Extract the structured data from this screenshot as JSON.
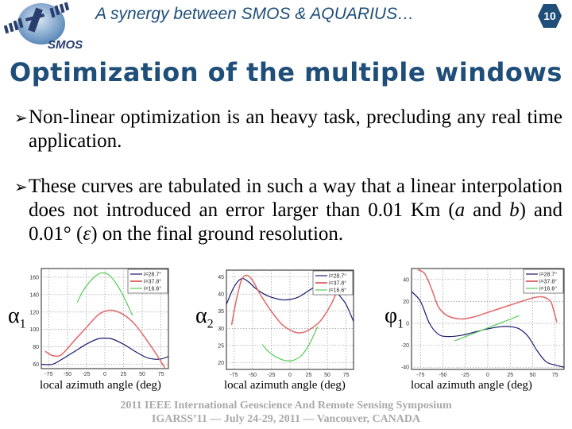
{
  "header": {
    "logo_text": "SMOS",
    "title": "A synergy between SMOS & AQUARIUS…",
    "slide_number": "10",
    "accent_color": "#1f4e79"
  },
  "slide": {
    "title": "Optimization of the multiple windows",
    "bullets": [
      {
        "icon": "arrow-bullet-icon",
        "text": "Non-linear optimization is an heavy task, precluding any real time application."
      },
      {
        "icon": "arrow-bullet-icon",
        "text_parts": [
          "These curves are tabulated in such a way that a linear interpolation does not introduced an error larger than 0.01 Km (",
          "a",
          " and ",
          "b",
          ") and 0.01° (",
          "ε",
          ") on the final ground resolution."
        ]
      }
    ]
  },
  "footer": {
    "line1": "2011 IEEE International Geoscience And Remote Sensing Symposium",
    "line2": "IGARSS’11 —  July 24-29, 2011 —  Vancouver, CANADA"
  },
  "chart_data": [
    {
      "type": "line",
      "ylabel": "α",
      "ylabel_sub": "1",
      "xlabel": "local azimuth angle (deg)",
      "xlim": [
        -85,
        85
      ],
      "ylim": [
        55,
        170
      ],
      "xticks": [
        -75,
        -50,
        -25,
        0,
        25,
        50,
        75
      ],
      "yticks": [
        60,
        80,
        100,
        120,
        140,
        160
      ],
      "grid": true,
      "legend": "top-right",
      "series": [
        {
          "name": "i=28.7°",
          "color": "#1a1a6e",
          "x": [
            -85,
            -70,
            -55,
            -40,
            -25,
            -10,
            0,
            10,
            25,
            40,
            55,
            65,
            75,
            85
          ],
          "y": [
            60,
            60,
            67,
            75,
            83,
            89,
            90,
            89,
            83,
            75,
            68,
            66,
            66,
            69
          ]
        },
        {
          "name": "i=37.8°",
          "color": "#e07070",
          "x": [
            -80,
            -70,
            -60,
            -50,
            -40,
            -25,
            -10,
            0,
            10,
            25,
            40,
            55,
            70,
            80
          ],
          "y": [
            75,
            70,
            70,
            78,
            88,
            102,
            116,
            121,
            122,
            117,
            106,
            89,
            70,
            56
          ]
        },
        {
          "name": "i=16.6°",
          "color": "#55cc55",
          "x": [
            -37,
            -30,
            -20,
            -10,
            -3,
            5,
            15,
            25,
            37
          ],
          "y": [
            131,
            143,
            155,
            163,
            165,
            163,
            153,
            138,
            116
          ]
        }
      ]
    },
    {
      "type": "line",
      "ylabel": "α",
      "ylabel_sub": "2",
      "xlabel": "local azimuth angle (deg)",
      "xlim": [
        -85,
        85
      ],
      "ylim": [
        18,
        47
      ],
      "xticks": [
        -75,
        -50,
        -25,
        0,
        25,
        50,
        75
      ],
      "yticks": [
        20,
        25,
        30,
        35,
        40,
        45
      ],
      "grid": true,
      "legend": "top-right",
      "series": [
        {
          "name": "i=28.7°",
          "color": "#1a1a6e",
          "x": [
            -85,
            -75,
            -65,
            -55,
            -45,
            -30,
            -15,
            -5,
            10,
            25,
            40,
            55,
            65,
            75,
            85
          ],
          "y": [
            37,
            42,
            44.5,
            43.5,
            41.5,
            39.5,
            38.5,
            38.3,
            39,
            41,
            43,
            44,
            40,
            37,
            32
          ]
        },
        {
          "name": "i=37.8°",
          "color": "#e07070",
          "x": [
            -78,
            -72,
            -65,
            -58,
            -50,
            -40,
            -25,
            -10,
            5,
            15,
            25,
            40,
            55,
            65
          ],
          "y": [
            31,
            38,
            44,
            45.5,
            44,
            40,
            35,
            31,
            29,
            28.7,
            29.5,
            32,
            37,
            42
          ]
        },
        {
          "name": "i=16.6°",
          "color": "#55cc55",
          "x": [
            -37,
            -30,
            -20,
            -10,
            -3,
            5,
            15,
            25,
            37
          ],
          "y": [
            25.3,
            23.5,
            21.8,
            20.8,
            20.5,
            20.7,
            22,
            25,
            30.5
          ]
        }
      ]
    },
    {
      "type": "line",
      "ylabel": "φ",
      "ylabel_sub": "1",
      "xlabel": "local azimuth angle (deg)",
      "xlim": [
        -85,
        85
      ],
      "ylim": [
        -42,
        50
      ],
      "xticks": [
        -75,
        -50,
        -25,
        0,
        25,
        50,
        75
      ],
      "yticks": [
        -40,
        -20,
        0,
        20,
        40
      ],
      "grid": true,
      "legend": "top-right",
      "series": [
        {
          "name": "i=28.7°",
          "color": "#1a1a6e",
          "x": [
            -85,
            -75,
            -65,
            -55,
            -45,
            -30,
            -15,
            0,
            15,
            25,
            35,
            45,
            55,
            65,
            75,
            85
          ],
          "y": [
            29,
            20,
            0,
            -10,
            -12,
            -11,
            -8,
            -5,
            -3,
            -3,
            -5,
            -12,
            -25,
            -35,
            -38,
            -40
          ]
        },
        {
          "name": "i=37.8°",
          "color": "#e07070",
          "x": [
            -78,
            -70,
            -62,
            -55,
            -45,
            -30,
            -15,
            0,
            15,
            30,
            45,
            55,
            62,
            70,
            74,
            77
          ],
          "y": [
            49,
            45,
            30,
            15,
            7,
            4,
            6,
            10,
            14,
            18,
            22,
            24,
            24,
            20,
            10,
            1
          ]
        },
        {
          "name": "i=16.6°",
          "color": "#55cc55",
          "x": [
            -37,
            35
          ],
          "y": [
            -16,
            7
          ]
        }
      ]
    }
  ]
}
